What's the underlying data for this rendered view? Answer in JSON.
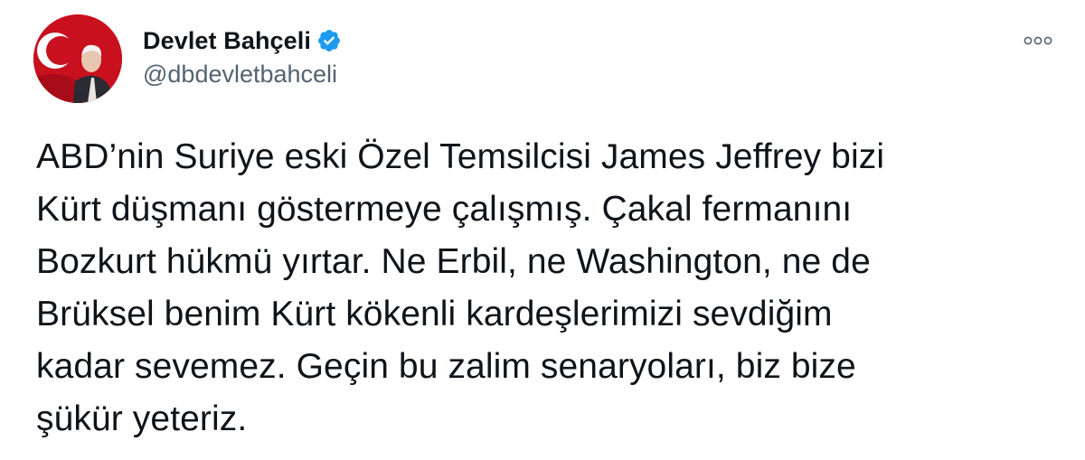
{
  "author": {
    "display_name": "Devlet Bahçeli",
    "handle": "@dbdevletbahceli",
    "verified": true,
    "avatar_icon": "profile-photo"
  },
  "tweet": {
    "text": "ABD’nin Suriye eski Özel Temsilcisi James Jeffrey bizi\nKürt düşmanı göstermeye çalışmış. Çakal fermanını\nBozkurt hükmü yırtar. Ne Erbil, ne Washington, ne de\nBrüksel benim Kürt kökenli kardeşlerimizi sevdiğim\nkadar sevemez. Geçin bu zalim senaryoları, biz bize\nşükür yeteriz."
  },
  "colors": {
    "verified_badge": "#1d9bf0",
    "handle_text": "#536471",
    "primary_text": "#0f1419",
    "avatar_background": "#c8101f"
  }
}
